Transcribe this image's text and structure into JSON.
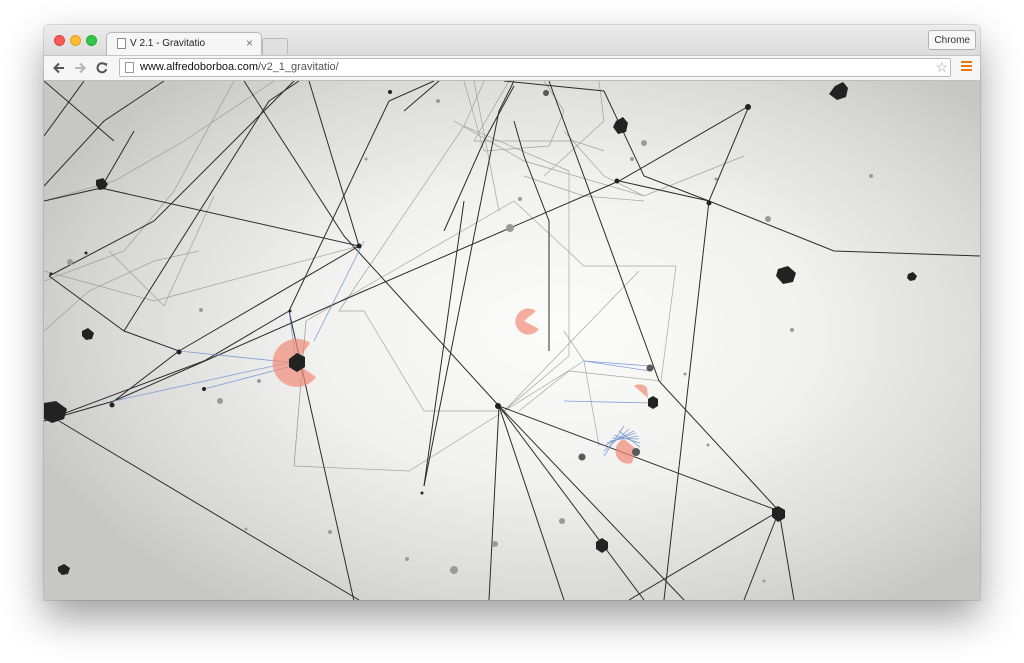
{
  "tab": {
    "title": "V 2.1 - Gravitatio",
    "close": "×"
  },
  "profile_button": "Chrome",
  "address": {
    "host": "www.alfredoborboa.com",
    "path": "/v2_1_gravitatio/"
  },
  "icons": {
    "back": "back-arrow-icon",
    "forward": "forward-arrow-icon",
    "reload": "reload-icon",
    "star": "bookmark-star-icon",
    "menu": "hamburger-menu-icon"
  },
  "colors": {
    "close": "#fc5b57",
    "minimize": "#fdbc2e",
    "maximize": "#33c748",
    "menu_accent": "#e8780e",
    "blob_red": "#f08a76",
    "blob_blue": "#6d8fd4",
    "node": "#222222"
  }
}
